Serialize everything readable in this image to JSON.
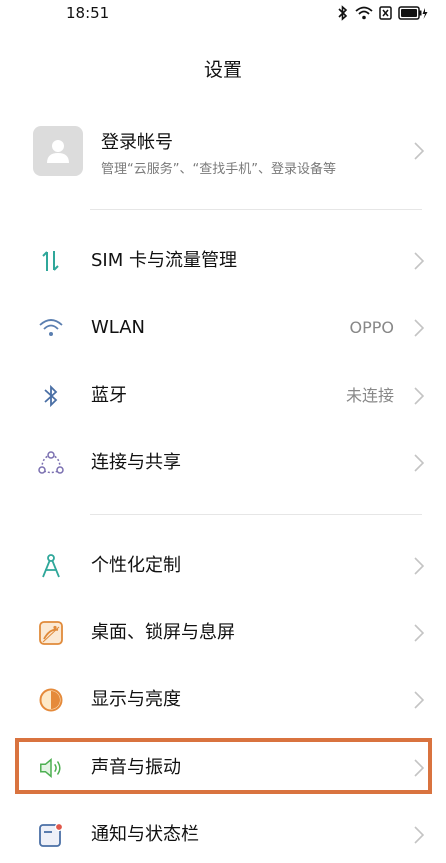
{
  "status_bar": {
    "time": "18:51",
    "icons": [
      "bluetooth-icon",
      "wifi-icon",
      "sim-off-icon",
      "battery-charging-icon"
    ]
  },
  "header": {
    "title": "设置"
  },
  "account": {
    "title": "登录帐号",
    "subtitle": "管理“云服务”、“查找手机”、登录设备等",
    "avatar_icon": "user-icon"
  },
  "sections": [
    [
      {
        "id": "sim",
        "label": "SIM 卡与流量管理",
        "icon": "sim-data-icon",
        "value": ""
      },
      {
        "id": "wlan",
        "label": "WLAN",
        "icon": "wifi-icon",
        "value": "OPPO"
      },
      {
        "id": "bluetooth",
        "label": "蓝牙",
        "icon": "bluetooth-icon",
        "value": "未连接"
      },
      {
        "id": "connection",
        "label": "连接与共享",
        "icon": "share-icon",
        "value": ""
      }
    ],
    [
      {
        "id": "personalize",
        "label": "个性化定制",
        "icon": "compass-icon",
        "value": ""
      },
      {
        "id": "wallpaper",
        "label": "桌面、锁屏与息屏",
        "icon": "wallpaper-icon",
        "value": ""
      },
      {
        "id": "display",
        "label": "显示与亮度",
        "icon": "brightness-icon",
        "value": ""
      },
      {
        "id": "sound",
        "label": "声音与振动",
        "icon": "speaker-icon",
        "value": ""
      },
      {
        "id": "notification",
        "label": "通知与状态栏",
        "icon": "notification-icon",
        "value": ""
      }
    ]
  ],
  "colors": {
    "accent_teal": "#2fa79a",
    "highlight": "#d9733f",
    "bluetooth_blue": "#4a6fa5",
    "orange": "#e58a3a",
    "green": "#4caf50"
  },
  "highlighted_item": "sound"
}
